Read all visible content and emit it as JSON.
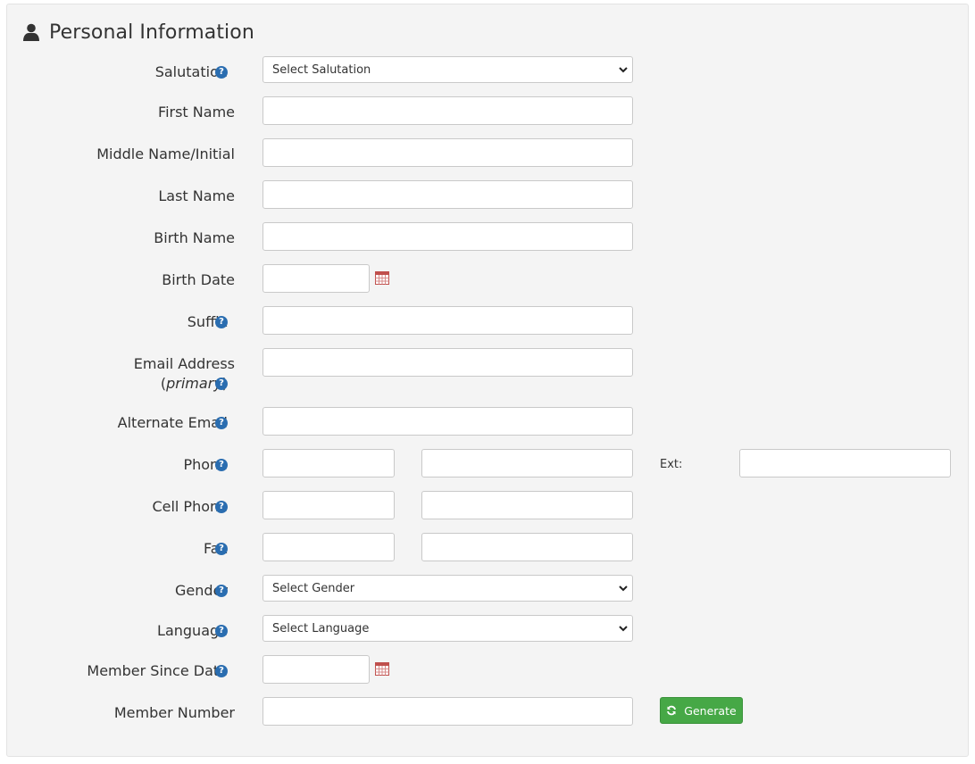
{
  "section": {
    "title": "Personal Information",
    "icon": "user-icon"
  },
  "fields": {
    "salutation": {
      "label": "Salutation",
      "value": "Select Salutation"
    },
    "first_name": {
      "label": "First Name",
      "value": ""
    },
    "middle_name": {
      "label": "Middle Name/Initial",
      "value": ""
    },
    "last_name": {
      "label": "Last Name",
      "value": ""
    },
    "birth_name": {
      "label": "Birth Name",
      "value": ""
    },
    "birth_date": {
      "label": "Birth Date",
      "value": ""
    },
    "suffix": {
      "label": "Suffix",
      "value": ""
    },
    "email_primary": {
      "label": "Email Address",
      "label_open": "(",
      "label_note": "primary",
      "label_close": ")",
      "value": ""
    },
    "alternate_email": {
      "label": "Alternate Email",
      "value": ""
    },
    "phone": {
      "label": "Phone",
      "ext_label": "Ext:",
      "value": ""
    },
    "cell_phone": {
      "label": "Cell Phone",
      "value": ""
    },
    "fax": {
      "label": "Fax",
      "value": ""
    },
    "gender": {
      "label": "Gender",
      "value": "Select Gender"
    },
    "language": {
      "label": "Language",
      "value": "Select Language"
    },
    "member_since": {
      "label": "Member Since Date",
      "value": ""
    },
    "member_number": {
      "label": "Member Number",
      "value": ""
    }
  },
  "help_glyph": "?",
  "generate_button": {
    "label": "Generate"
  },
  "colors": {
    "panel_bg": "#f4f4f4",
    "help_icon": "#2a6db0",
    "generate_button": "#46a846"
  }
}
